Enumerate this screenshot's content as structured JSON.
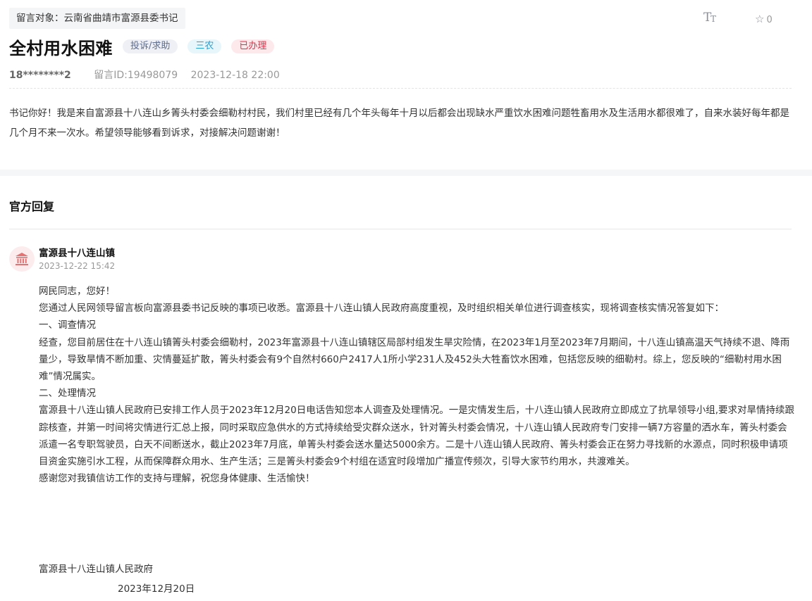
{
  "message": {
    "target_label": "留言对象：云南省曲靖市富源县委书记",
    "title": "全村用水困难",
    "tags": {
      "type": "投诉/求助",
      "domain": "三农",
      "status": "已办理"
    },
    "user": "18********2",
    "message_id": "留言ID:19498079",
    "datetime": "2023-12-18 22:00",
    "favorite_count": "0",
    "body": "书记你好！我是来自富源县十八连山乡箐头村委会细勒村村民，我们村里已经有几个年头每年十月以后都会出现缺水严重饮水困难问题牲畜用水及生活用水都很难了，自来水装好每年都是几个月不来一次水。希望领导能够看到诉求，对接解决问题谢谢！"
  },
  "icons": {
    "font_size": "text-size-icon",
    "favorite": "star-outline-icon",
    "org_avatar": "government-building-icon"
  },
  "colors": {
    "tag_type_text": "#5e6c8c",
    "tag_domain_text": "#2a9fd1",
    "tag_status_text": "#d7354a",
    "avatar_icon": "#e57373"
  },
  "reply": {
    "heading": "官方回复",
    "org_name": "富源县十八连山镇",
    "datetime": "2023-12-22 15:42",
    "paragraphs": [
      "网民同志，您好！",
      "您通过人民网领导留言板向富源县委书记反映的事项已收悉。富源县十八连山镇人民政府高度重视，及时组织相关单位进行调查核实，现将调查核实情况答复如下：",
      "一、调查情况",
      "经查，您目前居住在十八连山镇箐头村委会细勒村，2023年富源县十八连山镇辖区局部村组发生旱灾险情，在2023年1月至2023年7月期间，十八连山镇高温天气持续不退、降雨量少，导致旱情不断加重、灾情蔓延扩散，箐头村委会有9个自然村660户2417人1所小学231人及452头大牲畜饮水困难，包括您反映的细勒村。综上，您反映的“细勒村用水困难”情况属实。",
      "二、处理情况",
      "富源县十八连山镇人民政府已安排工作人员于2023年12月20日电话告知您本人调查及处理情况。一是灾情发生后，十八连山镇人民政府立即成立了抗旱领导小组,要求对旱情持续跟踪核查，并第一时间将灾情进行汇总上报，同时采取应急供水的方式持续给受灾群众送水，针对箐头村委会情况，十八连山镇人民政府专门安排一辆7方容量的洒水车，箐头村委会派遣一名专职驾驶员，白天不间断送水，截止2023年7月底，单箐头村委会送水量达5000余方。二是十八连山镇人民政府、箐头村委会正在努力寻找新的水源点，同时积极申请项目资金实施引水工程，从而保障群众用水、生产生活；三是箐头村委会9个村组在适宜时段增加广播宣传频次，引导大家节约用水，共渡难关。",
      "感谢您对我镇信访工作的支持与理解，祝您身体健康、生活愉快！"
    ],
    "signature_org": "富源县十八连山镇人民政府",
    "signature_date": "2023年12月20日"
  }
}
